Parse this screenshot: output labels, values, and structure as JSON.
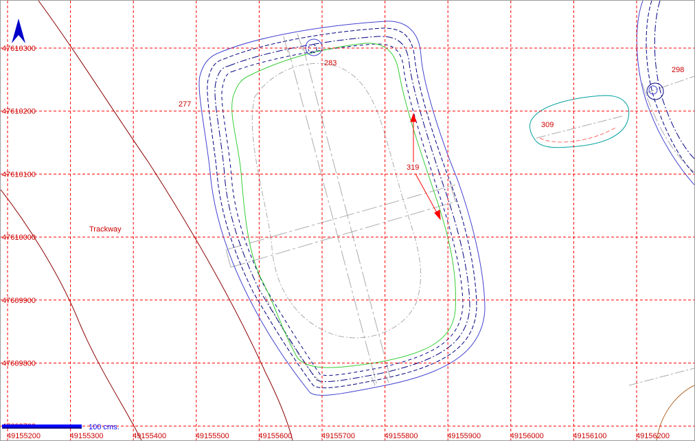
{
  "map": {
    "grid": {
      "x_labels": [
        "49155200",
        "49155300",
        "49155400",
        "49155500",
        "49155600",
        "49155700",
        "49155800",
        "49155900",
        "49156000",
        "49156100",
        "49156200"
      ],
      "y_labels": [
        "47610300",
        "47610200",
        "47610100",
        "47610000",
        "47609900",
        "47609800",
        "47609700"
      ],
      "x_min": 49155200,
      "x_max": 49156200,
      "y_min": 47609700,
      "y_max": 47610300,
      "color": "#ff0000"
    },
    "labels": {
      "trackway": "Trackway",
      "feature_277": "277",
      "feature_283": "283",
      "feature_298": "298",
      "feature_309": "309",
      "feature_319": "319"
    },
    "scale_bar": {
      "text": "100 cms.",
      "color": "#0000ff"
    },
    "north_arrow": {
      "icon": "north-arrow-icon",
      "color": "#0000c8"
    },
    "colors": {
      "enclosure_outer": "#4040d0",
      "enclosure_dash": "#000080",
      "inner_green": "#33cc33",
      "grey_features": "#aaaaaa",
      "trackway_line": "#8b0000",
      "feature_309_outline": "#00a0a0",
      "annotation_red": "#ff0000",
      "corner_contour": "#b06020"
    }
  }
}
